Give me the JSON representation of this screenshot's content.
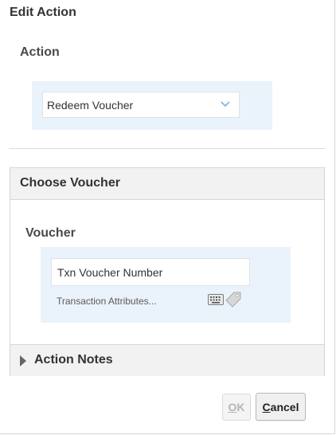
{
  "dialog": {
    "title": "Edit Action"
  },
  "action": {
    "label": "Action",
    "select_value": "Redeem Voucher",
    "chevron_icon": "chevron-down-icon"
  },
  "choose_voucher": {
    "header": "Choose Voucher",
    "voucher_label": "Voucher",
    "voucher_input_value": "Txn Voucher Number",
    "transaction_attributes_link": "Transaction Attributes...",
    "keyboard_icon": "keyboard-icon",
    "tag_icon": "tag-icon"
  },
  "action_notes": {
    "label": "Action Notes",
    "expand_icon": "triangle-right-icon"
  },
  "buttons": {
    "ok_first": "O",
    "ok_rest": "K",
    "cancel_first": "C",
    "cancel_rest": "ancel"
  },
  "colors": {
    "panel_bg": "#eaf2fb",
    "header_bg": "#f2f2f2",
    "chevron": "#7fb3d9"
  }
}
